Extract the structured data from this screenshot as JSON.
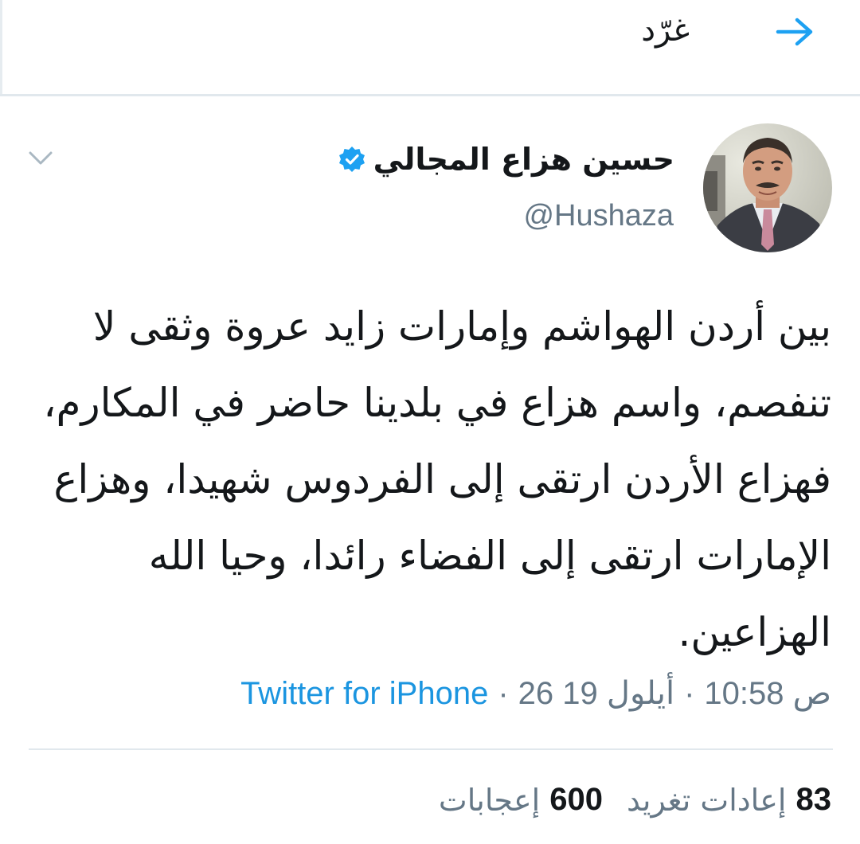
{
  "header": {
    "title": "غرّد",
    "back_icon": "arrow-right-icon"
  },
  "tweet": {
    "author": {
      "display_name": "حسين هزاع المجالي",
      "handle": "@Hushaza",
      "verified_icon": "verified-badge-icon"
    },
    "text": "بين أردن الهواشم وإمارات زايد عروة وثقى لا تنفصم، واسم هزاع في بلدينا حاضر في المكارم، فهزاع الأردن ارتقى إلى الفردوس شهيدا، وهزاع الإمارات ارتقى إلى الفضاء رائدا، وحيا الله الهزاعين.",
    "time": "10:58 ص",
    "date": "26 أيلول 19",
    "source": "Twitter for iPhone",
    "separator": "·"
  },
  "stats": {
    "retweets_count": "83",
    "retweets_label": "إعادات تغريد",
    "likes_count": "600",
    "likes_label": "إعجابات"
  },
  "colors": {
    "accent": "#1da1f2",
    "link": "#1b95e0",
    "secondary_text": "#657786",
    "primary_text": "#14171a",
    "divider": "#e1e8ed"
  }
}
